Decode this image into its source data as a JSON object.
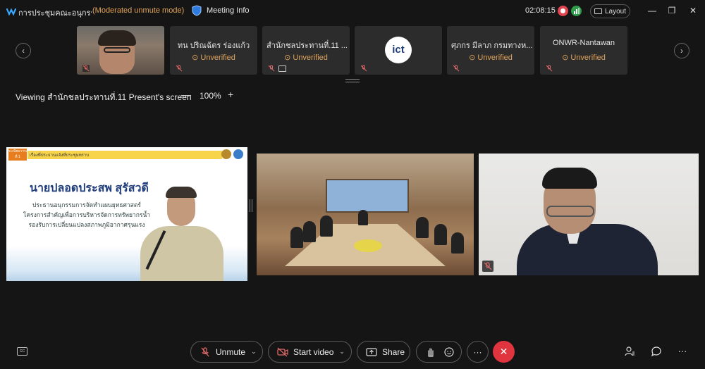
{
  "window": {
    "meeting_title": "การประชุมคณะอนุกรรม...",
    "mode": "(Moderated unmute mode)",
    "meeting_info_label": "Meeting Info",
    "timer": "02:08:15",
    "layout_label": "Layout",
    "minimize": "—",
    "restore": "❐",
    "close": "✕"
  },
  "thumbnails": {
    "prev": "‹",
    "next": "›",
    "items": [
      {
        "name": "",
        "status": ""
      },
      {
        "name": "ทน ปริณฉัตร ร่องแก้ว",
        "status": "Unverified"
      },
      {
        "name": "สำนักชลประทานที่.11 ...",
        "status": "Unverified"
      },
      {
        "name": "",
        "status": "",
        "logo_text": "ict"
      },
      {
        "name": "ศุภกร มีลาภ กรมทางห...",
        "status": "Unverified"
      },
      {
        "name": "ONWR-Nantawan",
        "status": "Unverified"
      }
    ]
  },
  "viewing": {
    "label": "Viewing สำนักชลประทานที่.11 Present's screen",
    "zoom_out": "—",
    "zoom_level": "100%",
    "zoom_in": "+"
  },
  "slide": {
    "badge": "ระเบียบวาระที่ 1",
    "topic": "เรื่องที่ประธานแจ้งที่ประชุมทราบ",
    "speaker_name": "นายปลอดประสพ สุรัสวดี",
    "lines": [
      "ประธานอนุกรรมการจัดทำแผนยุทธศาสตร์",
      "โครงการสำคัญเพื่อการบริหารจัดการทรัพยากรน้ำ",
      "รองรับการเปลี่ยนแปลงสภาพภูมิอากาศรุนแรง"
    ]
  },
  "controls": {
    "unmute": "Unmute",
    "start_video": "Start video",
    "share": "Share",
    "more": "···",
    "leave": "✕",
    "right_more": "···"
  },
  "colors": {
    "accent_orange": "#e0a35a",
    "leave_red": "#e0343f",
    "record_red": "#e0454f",
    "signal_green": "#2f9c4c"
  }
}
